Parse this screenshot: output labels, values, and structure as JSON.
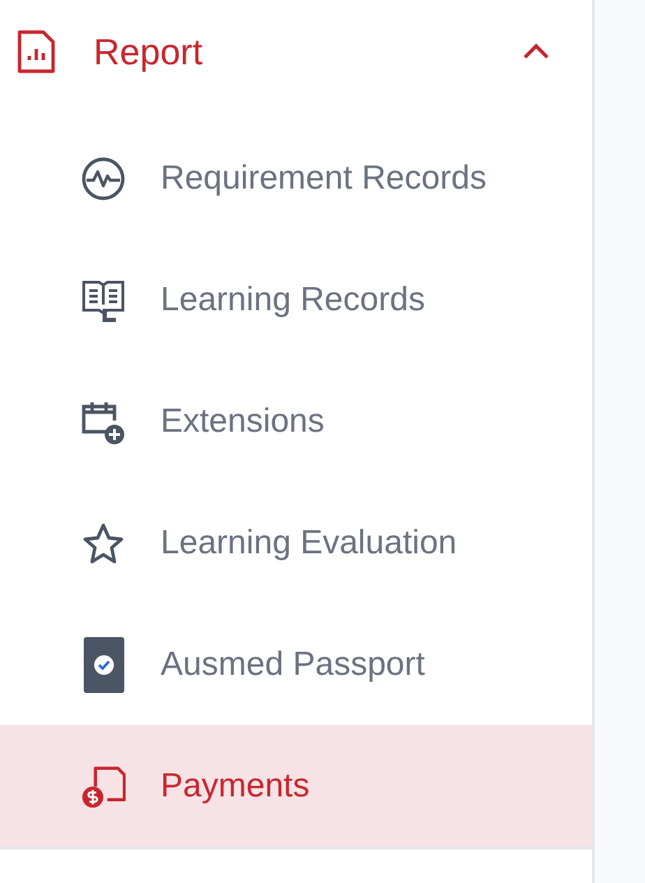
{
  "section": {
    "title": "Report",
    "expanded": true,
    "items": [
      {
        "label": "Requirement Records",
        "selected": false
      },
      {
        "label": "Learning Records",
        "selected": false
      },
      {
        "label": "Extensions",
        "selected": false
      },
      {
        "label": "Learning Evaluation",
        "selected": false
      },
      {
        "label": "Ausmed Passport",
        "selected": false
      },
      {
        "label": "Payments",
        "selected": true
      }
    ]
  }
}
